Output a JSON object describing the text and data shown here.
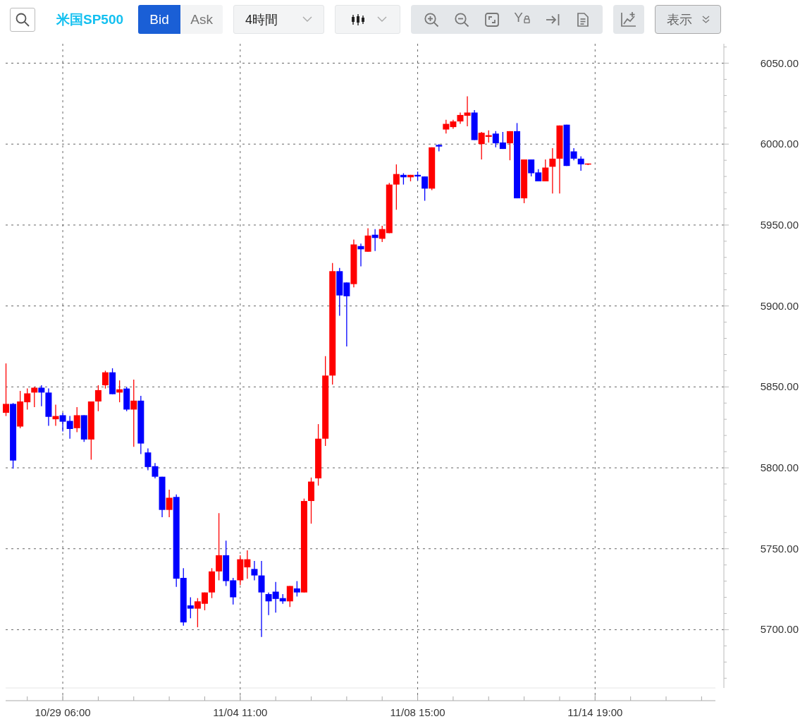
{
  "toolbar": {
    "symbol": "米国SP500",
    "price_tabs": [
      {
        "label": "Bid",
        "selected": true
      },
      {
        "label": "Ask",
        "selected": false
      }
    ],
    "timeframe": "4時間",
    "y_lock_label": "Y",
    "display_button": "表示"
  },
  "chart": {
    "chart_data": {
      "type": "candlestick",
      "grid": true,
      "ylim": [
        5664,
        6062
      ],
      "categories": [
        null,
        null,
        null,
        null,
        null,
        null,
        null,
        null,
        "10/29 06:00",
        null,
        null,
        null,
        null,
        null,
        null,
        null,
        null,
        null,
        null,
        null,
        null,
        null,
        null,
        null,
        null,
        null,
        null,
        null,
        null,
        null,
        null,
        null,
        null,
        "11/04 11:00",
        null,
        null,
        null,
        null,
        null,
        null,
        null,
        null,
        null,
        null,
        null,
        null,
        null,
        null,
        null,
        null,
        null,
        null,
        null,
        null,
        null,
        null,
        null,
        null,
        "11/08 15:00",
        null,
        null,
        null,
        null,
        null,
        null,
        null,
        null,
        null,
        null,
        null,
        null,
        null,
        null,
        null,
        null,
        null,
        null,
        null,
        null,
        null,
        null,
        null,
        null,
        "11/14 19:00",
        null,
        null,
        null,
        null,
        null,
        null,
        null,
        null,
        null,
        null,
        null,
        null,
        null,
        null,
        null,
        null
      ],
      "yticks": [
        {
          "value": 5700,
          "label": "5700.00"
        },
        {
          "value": 5750,
          "label": "5750.00"
        },
        {
          "value": 5800,
          "label": "5800.00"
        },
        {
          "value": 5850,
          "label": "5850.00"
        },
        {
          "value": 5900,
          "label": "5900.00"
        },
        {
          "value": 5950,
          "label": "5950.00"
        },
        {
          "value": 6000,
          "label": "6000.00"
        },
        {
          "value": 6050,
          "label": "6050.00"
        }
      ],
      "ohlc": [
        [
          5834,
          5864.5,
          5832,
          5839.5
        ],
        [
          5839.5,
          5840,
          5799.5,
          5804.5
        ],
        [
          5825.5,
          5847.5,
          5824.5,
          5841
        ],
        [
          5840.5,
          5849,
          5836,
          5846
        ],
        [
          5846.5,
          5850,
          5837.5,
          5849.5
        ],
        [
          5849.5,
          5851,
          5838,
          5846.5
        ],
        [
          5846.5,
          5849,
          5826,
          5831.5
        ],
        [
          5830,
          5839,
          5826,
          5832
        ],
        [
          5832.5,
          5834,
          5822.5,
          5828.5
        ],
        [
          5829,
          5832,
          5818,
          5824
        ],
        [
          5824.5,
          5837.5,
          5822,
          5832.5
        ],
        [
          5832.5,
          5832.5,
          5816,
          5817.5
        ],
        [
          5817.5,
          5841,
          5805,
          5841
        ],
        [
          5841,
          5851,
          5835,
          5848
        ],
        [
          5851,
          5860,
          5849,
          5859
        ],
        [
          5859,
          5861.5,
          5845.5,
          5845.5
        ],
        [
          5846.5,
          5854,
          5840.5,
          5848.5
        ],
        [
          5849,
          5850,
          5835,
          5836
        ],
        [
          5836,
          5854.5,
          5813,
          5841.5
        ],
        [
          5841.5,
          5844.5,
          5808.5,
          5815
        ],
        [
          5809.5,
          5812,
          5798.5,
          5800.5
        ],
        [
          5801,
          5803,
          5793.5,
          5794.5
        ],
        [
          5794.5,
          5794.5,
          5769.5,
          5774
        ],
        [
          5774,
          5786.5,
          5769.5,
          5781.5
        ],
        [
          5782,
          5783.5,
          5726.5,
          5731.5
        ],
        [
          5732,
          5738,
          5702.5,
          5704.5
        ],
        [
          5715,
          5720,
          5707,
          5713
        ],
        [
          5713,
          5719.5,
          5701.5,
          5717.5
        ],
        [
          5716,
          5723,
          5712,
          5723
        ],
        [
          5723,
          5738,
          5719.5,
          5736
        ],
        [
          5736,
          5772,
          5730.5,
          5746
        ],
        [
          5746,
          5755,
          5727,
          5730
        ],
        [
          5730.5,
          5732,
          5715.5,
          5720
        ],
        [
          5730.5,
          5746,
          5727.5,
          5743.5
        ],
        [
          5738.5,
          5749,
          5731.5,
          5743.5
        ],
        [
          5737.5,
          5742.5,
          5730.5,
          5733.5
        ],
        [
          5733.5,
          5742.5,
          5695.5,
          5723
        ],
        [
          5722,
          5723,
          5709,
          5717.5
        ],
        [
          5723.5,
          5729.5,
          5710.5,
          5719
        ],
        [
          5719.5,
          5722,
          5716,
          5717.5
        ],
        [
          5717.5,
          5727,
          5714,
          5727
        ],
        [
          5725.5,
          5730,
          5720.5,
          5723
        ],
        [
          5723,
          5781,
          5723,
          5779.5
        ],
        [
          5779.5,
          5794,
          5765.5,
          5791.5
        ],
        [
          5793.5,
          5827,
          5789,
          5818
        ],
        [
          5818,
          5869,
          5813.5,
          5857
        ],
        [
          5857,
          5926.5,
          5851.5,
          5921.5
        ],
        [
          5921.5,
          5923.5,
          5894,
          5906.5
        ],
        [
          5914.5,
          5914.5,
          5875,
          5906
        ],
        [
          5913.5,
          5941,
          5911.5,
          5938
        ],
        [
          5937,
          5938.5,
          5924.5,
          5935
        ],
        [
          5933.5,
          5948,
          5933.5,
          5943.5
        ],
        [
          5944,
          5947.5,
          5934,
          5942
        ],
        [
          5941.5,
          5949.5,
          5939.5,
          5947.5
        ],
        [
          5945,
          5976,
          5945,
          5975
        ],
        [
          5975,
          5987.5,
          5959.5,
          5981.5
        ],
        [
          5981,
          5982,
          5975,
          5979.5
        ],
        [
          5979.5,
          5981,
          5977,
          5981
        ],
        [
          5981,
          5983,
          5977.5,
          5980
        ],
        [
          5980,
          5980,
          5965,
          5972.5
        ],
        [
          5972.5,
          5998,
          5971.5,
          5998
        ],
        [
          5999.5,
          6000,
          5995.5,
          5998.5
        ],
        [
          6009,
          6015,
          6006.5,
          6012.5
        ],
        [
          6010.5,
          6015,
          6009.5,
          6014
        ],
        [
          6014,
          6019.5,
          6012.5,
          6018
        ],
        [
          6017.5,
          6029.5,
          6011,
          6019.5
        ],
        [
          6019.5,
          6021,
          6002.5,
          6002.5
        ],
        [
          6000,
          6007.5,
          5990.5,
          6007
        ],
        [
          6004.5,
          6008.5,
          6001,
          6005.5
        ],
        [
          6006.5,
          6008,
          5998,
          6000.5
        ],
        [
          6001,
          6007.5,
          5997,
          5997
        ],
        [
          6000.5,
          6008,
          5990,
          6008
        ],
        [
          6008,
          6013,
          5966.5,
          5966.5
        ],
        [
          5966.5,
          5990.5,
          5963.5,
          5990.5
        ],
        [
          5990.5,
          5990.5,
          5980,
          5982
        ],
        [
          5982.5,
          5984.5,
          5977,
          5977
        ],
        [
          5977,
          5990.5,
          5977,
          5985.5
        ],
        [
          5986,
          5997.5,
          5969.5,
          5991
        ],
        [
          5991,
          6011.5,
          5969.5,
          6011.5
        ],
        [
          6012,
          6012,
          5986.5,
          5986.5
        ],
        [
          5995.5,
          5997.5,
          5990,
          5991
        ],
        [
          5991,
          5992.5,
          5983.5,
          5987.5
        ],
        [
          5987.5,
          5988,
          5987,
          5988
        ],
        null,
        null,
        null,
        null,
        null,
        null,
        null,
        null,
        null,
        null,
        null,
        null,
        null,
        null,
        null,
        null,
        null
      ]
    }
  }
}
